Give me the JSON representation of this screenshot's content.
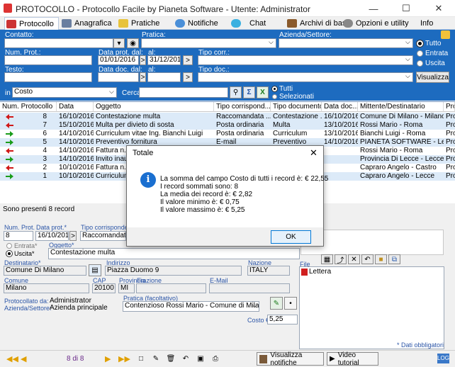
{
  "window": {
    "title": "PROTOCOLLO - Protocollo Facile by Pianeta Software - Utente: Administrator"
  },
  "menu": [
    {
      "label": "Protocollo",
      "icon": "protocol-icon"
    },
    {
      "label": "Anagrafica",
      "icon": "contacts-icon"
    },
    {
      "label": "Pratiche",
      "icon": "folder-icon"
    },
    {
      "label": "Notifiche",
      "icon": "bell-icon"
    },
    {
      "label": "Chat",
      "icon": "chat-icon"
    },
    {
      "label": "Archivi di base",
      "icon": "archive-icon"
    },
    {
      "label": "Opzioni e utility",
      "icon": "gear-icon"
    },
    {
      "label": "Info",
      "icon": "info-icon"
    }
  ],
  "filters": {
    "contatto_label": "Contatto:",
    "pratica_label": "Pratica:",
    "azienda_label": "Azienda/Settore:",
    "num_prot_label": "Num. Prot.:",
    "data_prot_dal_label": "Data prot. dal:",
    "data_prot_dal": "01/01/2016",
    "al_label": "al:",
    "data_prot_al": "31/12/2016",
    "tipo_corr_label": "Tipo corr.:",
    "testo_label": "Testo:",
    "data_doc_dal_label": "Data doc. dal:",
    "al2_label": "al:",
    "tipo_doc_label": "Tipo doc.:",
    "radio_tutto": "Tutto",
    "radio_entrata": "Entrata",
    "radio_uscita": "Uscita",
    "visualizza": "Visualizza",
    "btn_gt": ">"
  },
  "costbar": {
    "in_label": "in",
    "field_value": "Costo",
    "cerca_label": "Cerca",
    "radio_tutti": "Tutti",
    "radio_selezionati": "Selezionati"
  },
  "table": {
    "headers": [
      "Num. Protocollo",
      "Data",
      "Oggetto",
      "Tipo corrispond...",
      "Tipo documento",
      "Data doc...",
      "Mittente/Destinatario",
      "Pro"
    ],
    "rows": [
      {
        "dir": "out",
        "num": "8",
        "data": "16/10/2016",
        "oggetto": "Contestazione multa",
        "tipo_corr": "Raccomandata ...",
        "tipo_doc": "Contestazione ...",
        "data_doc": "16/10/2016",
        "mittente": "Comune Di Milano - Milano",
        "pro": "Pro"
      },
      {
        "dir": "out",
        "num": "7",
        "data": "15/10/2016",
        "oggetto": "Multa per divieto di sosta",
        "tipo_corr": "Posta ordinaria",
        "tipo_doc": "Multa",
        "data_doc": "13/10/2016",
        "mittente": "Rossi Mario - Roma",
        "pro": "Pro"
      },
      {
        "dir": "in",
        "num": "6",
        "data": "14/10/2016",
        "oggetto": "Curriculum vitae Ing. Bianchi Luigi",
        "tipo_corr": "Posta ordinaria",
        "tipo_doc": "Curriculum",
        "data_doc": "13/10/2016",
        "mittente": "Bianchi  Luigi - Roma",
        "pro": "Pro"
      },
      {
        "dir": "in",
        "num": "5",
        "data": "14/10/2016",
        "oggetto": "Preventivo fornitura",
        "tipo_corr": "E-mail",
        "tipo_doc": "Preventivo",
        "data_doc": "14/10/2016",
        "mittente": "PIANETA SOFTWARE - Lecce",
        "pro": "Pro"
      },
      {
        "dir": "out",
        "num": "4",
        "data": "14/10/2016",
        "oggetto": "Fattura n. 2",
        "tipo_corr": "",
        "tipo_doc": "",
        "data_doc": "",
        "mittente": "Rossi Mario - Roma",
        "pro": "Pro"
      },
      {
        "dir": "in",
        "num": "3",
        "data": "14/10/2016",
        "oggetto": "Invito inau",
        "tipo_corr": "",
        "tipo_doc": "",
        "data_doc": "",
        "mittente": "Provincia Di Lecce - Lecce",
        "pro": "Pro"
      },
      {
        "dir": "out",
        "num": "2",
        "data": "10/10/2016",
        "oggetto": "Fattura n. 2",
        "tipo_corr": "",
        "tipo_doc": "",
        "data_doc": "",
        "mittente": "Capraro Angelo - Castro",
        "pro": "Pro"
      },
      {
        "dir": "in",
        "num": "1",
        "data": "10/10/2016",
        "oggetto": "Curriculum",
        "tipo_corr": "",
        "tipo_doc": "",
        "data_doc": "",
        "mittente": "Capraro Angelo - Lecce",
        "pro": "Pro"
      }
    ]
  },
  "status": "Sono presenti 8 record",
  "form": {
    "num_prot_label": "Num. Prot.",
    "num_prot": "8",
    "data_prot_label": "Data prot.*",
    "data_prot": "16/10/2016",
    "tipo_corr_label": "Tipo corrisponder",
    "tipo_corr": "Raccomandata A",
    "entrata_label": "Entrata*",
    "uscita_label": "Uscita*",
    "oggetto_label": "Oggetto*",
    "oggetto": "Contestazione multa",
    "destinatario_label": "Destinatario*",
    "destinatario": "Comune Di Milano",
    "indirizzo_label": "Indirizzo",
    "indirizzo": "Piazza Duomo 9",
    "nazione_label": "Nazione",
    "nazione": "ITALY",
    "file_label": "File",
    "file_item": "Lettera",
    "comune_label": "Comune",
    "comune": "Milano",
    "cap_label": "CAP",
    "cap": "20100",
    "provincia_label": "Provincia",
    "provincia": "MI",
    "frazione_label": "Frazione",
    "email_label": "E-Mail",
    "protocollato_label": "Protocollato da:",
    "protocollato": "Administrator",
    "azienda_label": "Azienda/Settore:",
    "azienda": "Azienda principale",
    "pratica_label": "Pratica (facoltativo)",
    "pratica": "Contenzioso Rossi Mario - Comune di Milano -",
    "costo_label": "Costo €",
    "costo": "5,25",
    "dati_obbligatori": "* Dati obbligatori"
  },
  "footer": {
    "nav": "8 di 8",
    "visualizza_notifiche": "Visualizza notifiche",
    "video_tutorial": "Video tutorial",
    "log": "LOG"
  },
  "dialog": {
    "title": "Totale",
    "lines": [
      "La somma del campo Costo di tutti i record è: € 22,55",
      "I record sommati sono: 8",
      "La media dei record è: € 2,82",
      "Il valore minimo è: € 0,75",
      "Il valore massimo è: € 5,25"
    ],
    "ok": "OK"
  },
  "colors": {
    "accent": "#1d6bbf",
    "row_alt": "#dceaf8",
    "arrow_in": "#1a9c1a",
    "arrow_out": "#d01818"
  }
}
